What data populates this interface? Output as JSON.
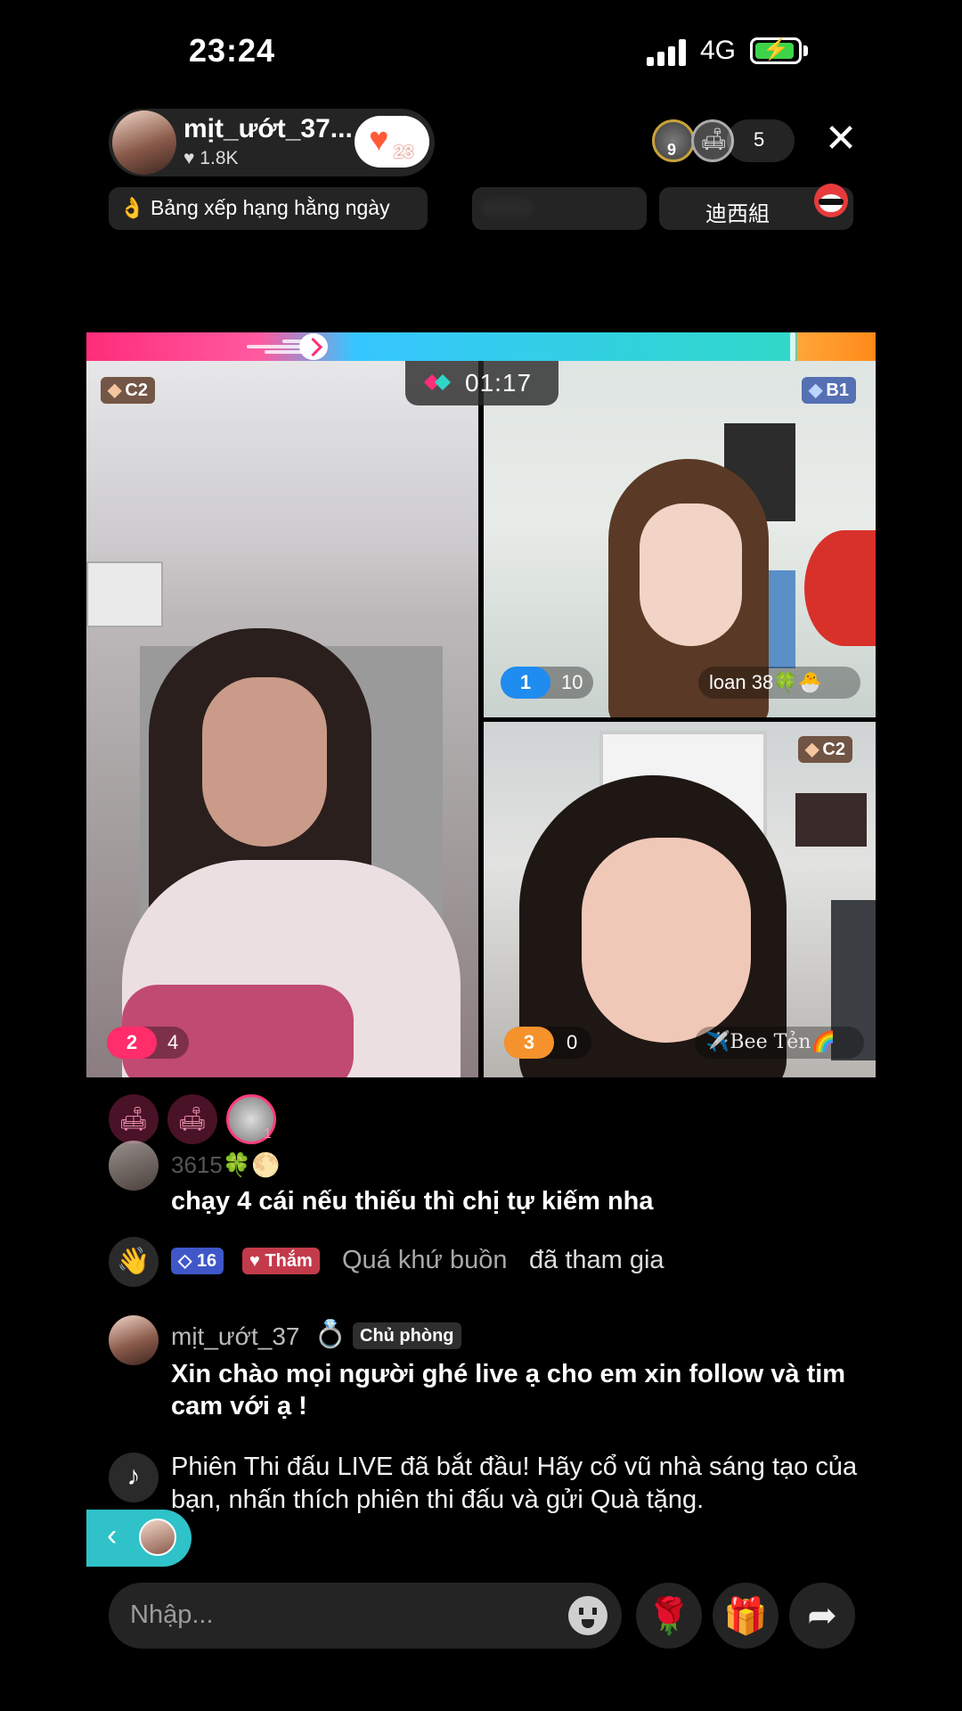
{
  "status_bar": {
    "time": "23:24",
    "network": "4G",
    "battery_charging": true
  },
  "host": {
    "name": "mịt_ướt_37...",
    "likes": "♥ 1.8K",
    "follow_count": "23"
  },
  "top_right": {
    "viewer_badge_level": "9",
    "viewer_count": "5",
    "close_glyph": "✕"
  },
  "info_row": {
    "daily_rank": "👌 Bảng xếp hạng hằng ngày",
    "team_name": "迪西組"
  },
  "battle": {
    "timer": "01:17"
  },
  "panes": {
    "left": {
      "tier": "C2",
      "rank": "2",
      "score": "4"
    },
    "top_right": {
      "tier": "B1",
      "rank": "1",
      "score": "10",
      "name": "loan 38🍀🐣"
    },
    "bottom_right": {
      "tier": "C2",
      "rank": "3",
      "score": "0",
      "name": "✈️Bee Tẻn🌈"
    }
  },
  "seats": {
    "seat_user_num": "1"
  },
  "comments": {
    "faded_partial": "3615🍀🌕",
    "line1": "chạy 4 cái nếu thiếu thì chị tự kiếm nha",
    "join": {
      "level_badge": "16",
      "fan_badge": "Thắm",
      "name": "Quá khứ buồn",
      "suffix": "đã tham gia"
    },
    "host_msg": {
      "name": "mịt_ướt_37",
      "role": "Chủ phòng",
      "text": "Xin chào mọi người  ghé live ạ cho em xin follow và tim cam với ạ !"
    },
    "system": {
      "text": "Phiên Thi đấu LIVE đã bắt đầu! Hãy cổ vũ nhà sáng tạo của bạn, nhấn thích phiên thi đấu và gửi Quà tặng."
    }
  },
  "bottom_bar": {
    "input_placeholder": "Nhập...",
    "rose_icon": "🌹",
    "gift_icon": "🎁",
    "share_icon": "➦"
  },
  "colors": {
    "accent_pink": "#ff2d7a",
    "accent_cyan": "#36c6ff",
    "accent_orange": "#ff8a1a",
    "rank1_blue": "#1f8cf0",
    "rank2_pink": "#ff2d6a",
    "rank3_orange": "#f5922b"
  }
}
